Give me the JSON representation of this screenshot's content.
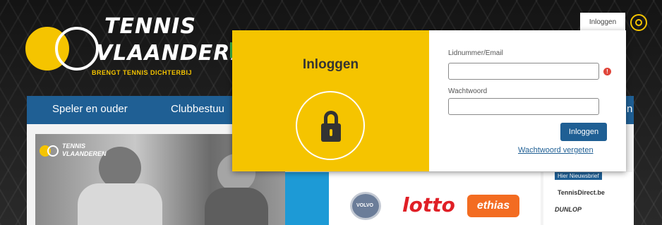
{
  "logo": {
    "line1": "TENNIS",
    "line2": "VLAANDEREN",
    "tagline": "BRENGT TENNIS DICHTERBIJ"
  },
  "nav": {
    "items": [
      "Speler en ouder",
      "Clubbestuu",
      "n"
    ]
  },
  "header": {
    "login_tab": "Inloggen"
  },
  "popup": {
    "title": "Inloggen",
    "field1_label": "Lidnummer/Email",
    "field2_label": "Wachtwoord",
    "field1_value": "",
    "field2_value": "",
    "submit_label": "Inloggen",
    "forgot_label": "Wachtwoord vergeten"
  },
  "photo": {
    "mini_logo_line1": "TENNIS",
    "mini_logo_line2": "VLAANDEREN"
  },
  "sponsors": {
    "volvo": "VOLVO",
    "lotto": "lotto",
    "ethias": "ethias",
    "tag": "Hier Nieuwsbrief",
    "right1": "TennisDirect.be",
    "right2": "DUNLOP"
  },
  "colors": {
    "accent_yellow": "#f5c400",
    "nav_blue": "#1f5f94",
    "error_red": "#e0453a"
  }
}
